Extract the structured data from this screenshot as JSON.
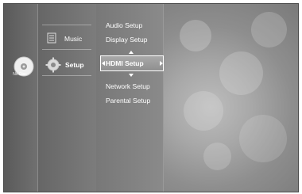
{
  "disc_status": {
    "label": "No Disc"
  },
  "main_menu": {
    "items": [
      {
        "label": "Music",
        "icon": "music-icon"
      },
      {
        "label": "Setup",
        "icon": "gear-icon",
        "selected": true
      }
    ]
  },
  "setup_menu": {
    "items": [
      {
        "label": "Audio Setup"
      },
      {
        "label": "Display Setup"
      },
      {
        "label": "HDMI Setup",
        "selected": true
      },
      {
        "label": "Network Setup"
      },
      {
        "label": "Parental Setup"
      }
    ]
  }
}
